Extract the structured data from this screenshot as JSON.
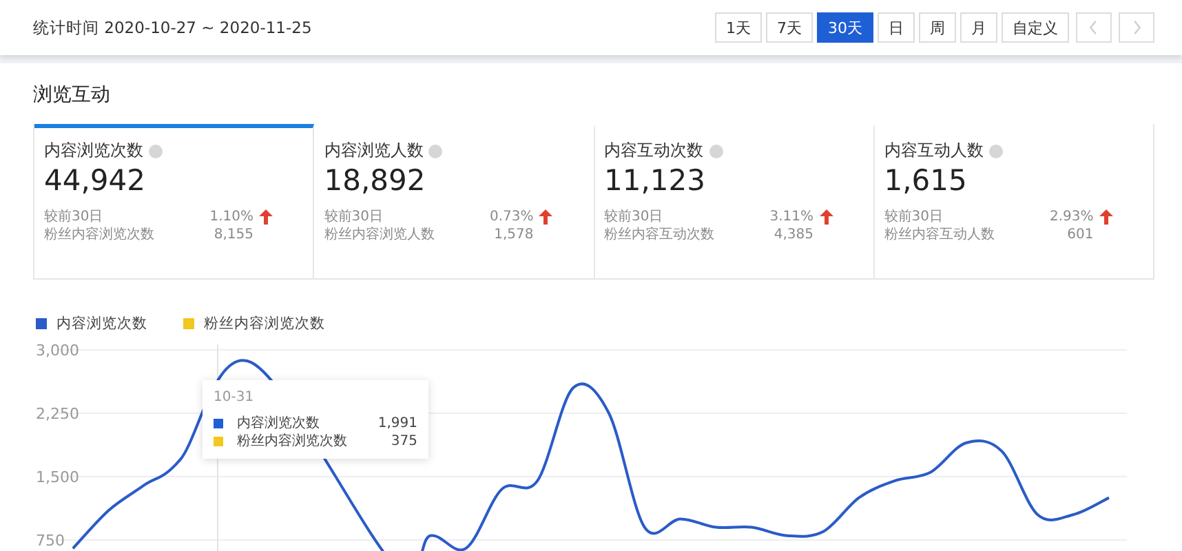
{
  "date_range": {
    "label": "统计时间",
    "value": "2020-10-27 ~ 2020-11-25"
  },
  "range_buttons": [
    {
      "label": "1天",
      "selected": false
    },
    {
      "label": "7天",
      "selected": false
    },
    {
      "label": "30天",
      "selected": true
    },
    {
      "label": "日",
      "selected": false
    },
    {
      "label": "周",
      "selected": false
    },
    {
      "label": "月",
      "selected": false
    },
    {
      "label": "自定义",
      "selected": false
    }
  ],
  "pager": [
    {
      "kind": "prev",
      "disabled": true
    },
    {
      "kind": "next",
      "disabled": true
    }
  ],
  "section_title": "浏览互动",
  "metrics": [
    {
      "title": "内容浏览次数",
      "value": "44,942",
      "compare_label": "较前30日",
      "compare_value": "1.10%",
      "rising": true,
      "fans_label": "粉丝内容浏览次数",
      "fans_value": "8,155",
      "selected": true
    },
    {
      "title": "内容浏览人数",
      "value": "18,892",
      "compare_label": "较前30日",
      "compare_value": "0.73%",
      "rising": true,
      "fans_label": "粉丝内容浏览人数",
      "fans_value": "1,578",
      "selected": false
    },
    {
      "title": "内容互动次数",
      "value": "11,123",
      "compare_label": "较前30日",
      "compare_value": "3.11%",
      "rising": true,
      "fans_label": "粉丝内容互动次数",
      "fans_value": "4,385",
      "selected": false
    },
    {
      "title": "内容互动人数",
      "value": "1,615",
      "compare_label": "较前30日",
      "compare_value": "2.93%",
      "rising": true,
      "fans_label": "粉丝内容互动人数",
      "fans_value": "601",
      "selected": false
    }
  ],
  "chart_data": {
    "type": "line",
    "grid": true,
    "ylim": [
      0,
      3000
    ],
    "yticks": [
      {
        "value": 750,
        "label": "750"
      },
      {
        "value": 1500,
        "label": "1,500"
      },
      {
        "value": 2250,
        "label": "2,250"
      },
      {
        "value": 3000,
        "label": "3,000"
      }
    ],
    "series": [
      {
        "name": "内容浏览次数",
        "color": "#2a5bc8",
        "values": [
          650,
          1100,
          1400,
          1700,
          null,
          2850,
          null,
          null,
          null,
          450,
          800,
          650,
          1350,
          1450,
          2550,
          2250,
          900,
          1000,
          900,
          900,
          800,
          850,
          1250,
          1450,
          1550,
          1900,
          1800,
          1050,
          1050,
          1250
        ]
      },
      {
        "name": "粉丝内容浏览次数",
        "color": "#f2c81e",
        "values": [
          null,
          null,
          null,
          null,
          null,
          null,
          null,
          null,
          null,
          null,
          null,
          null,
          null,
          null,
          null,
          null,
          null,
          null,
          null,
          null,
          null,
          null,
          null,
          null,
          null,
          null,
          null,
          null,
          null,
          null
        ]
      }
    ]
  },
  "tooltip": {
    "date": "10-31",
    "rows": [
      {
        "label": "内容浏览次数",
        "value": "1,991",
        "color": "#1f5fd6"
      },
      {
        "label": "粉丝内容浏览次数",
        "value": "375",
        "color": "#f2c81e"
      }
    ]
  }
}
